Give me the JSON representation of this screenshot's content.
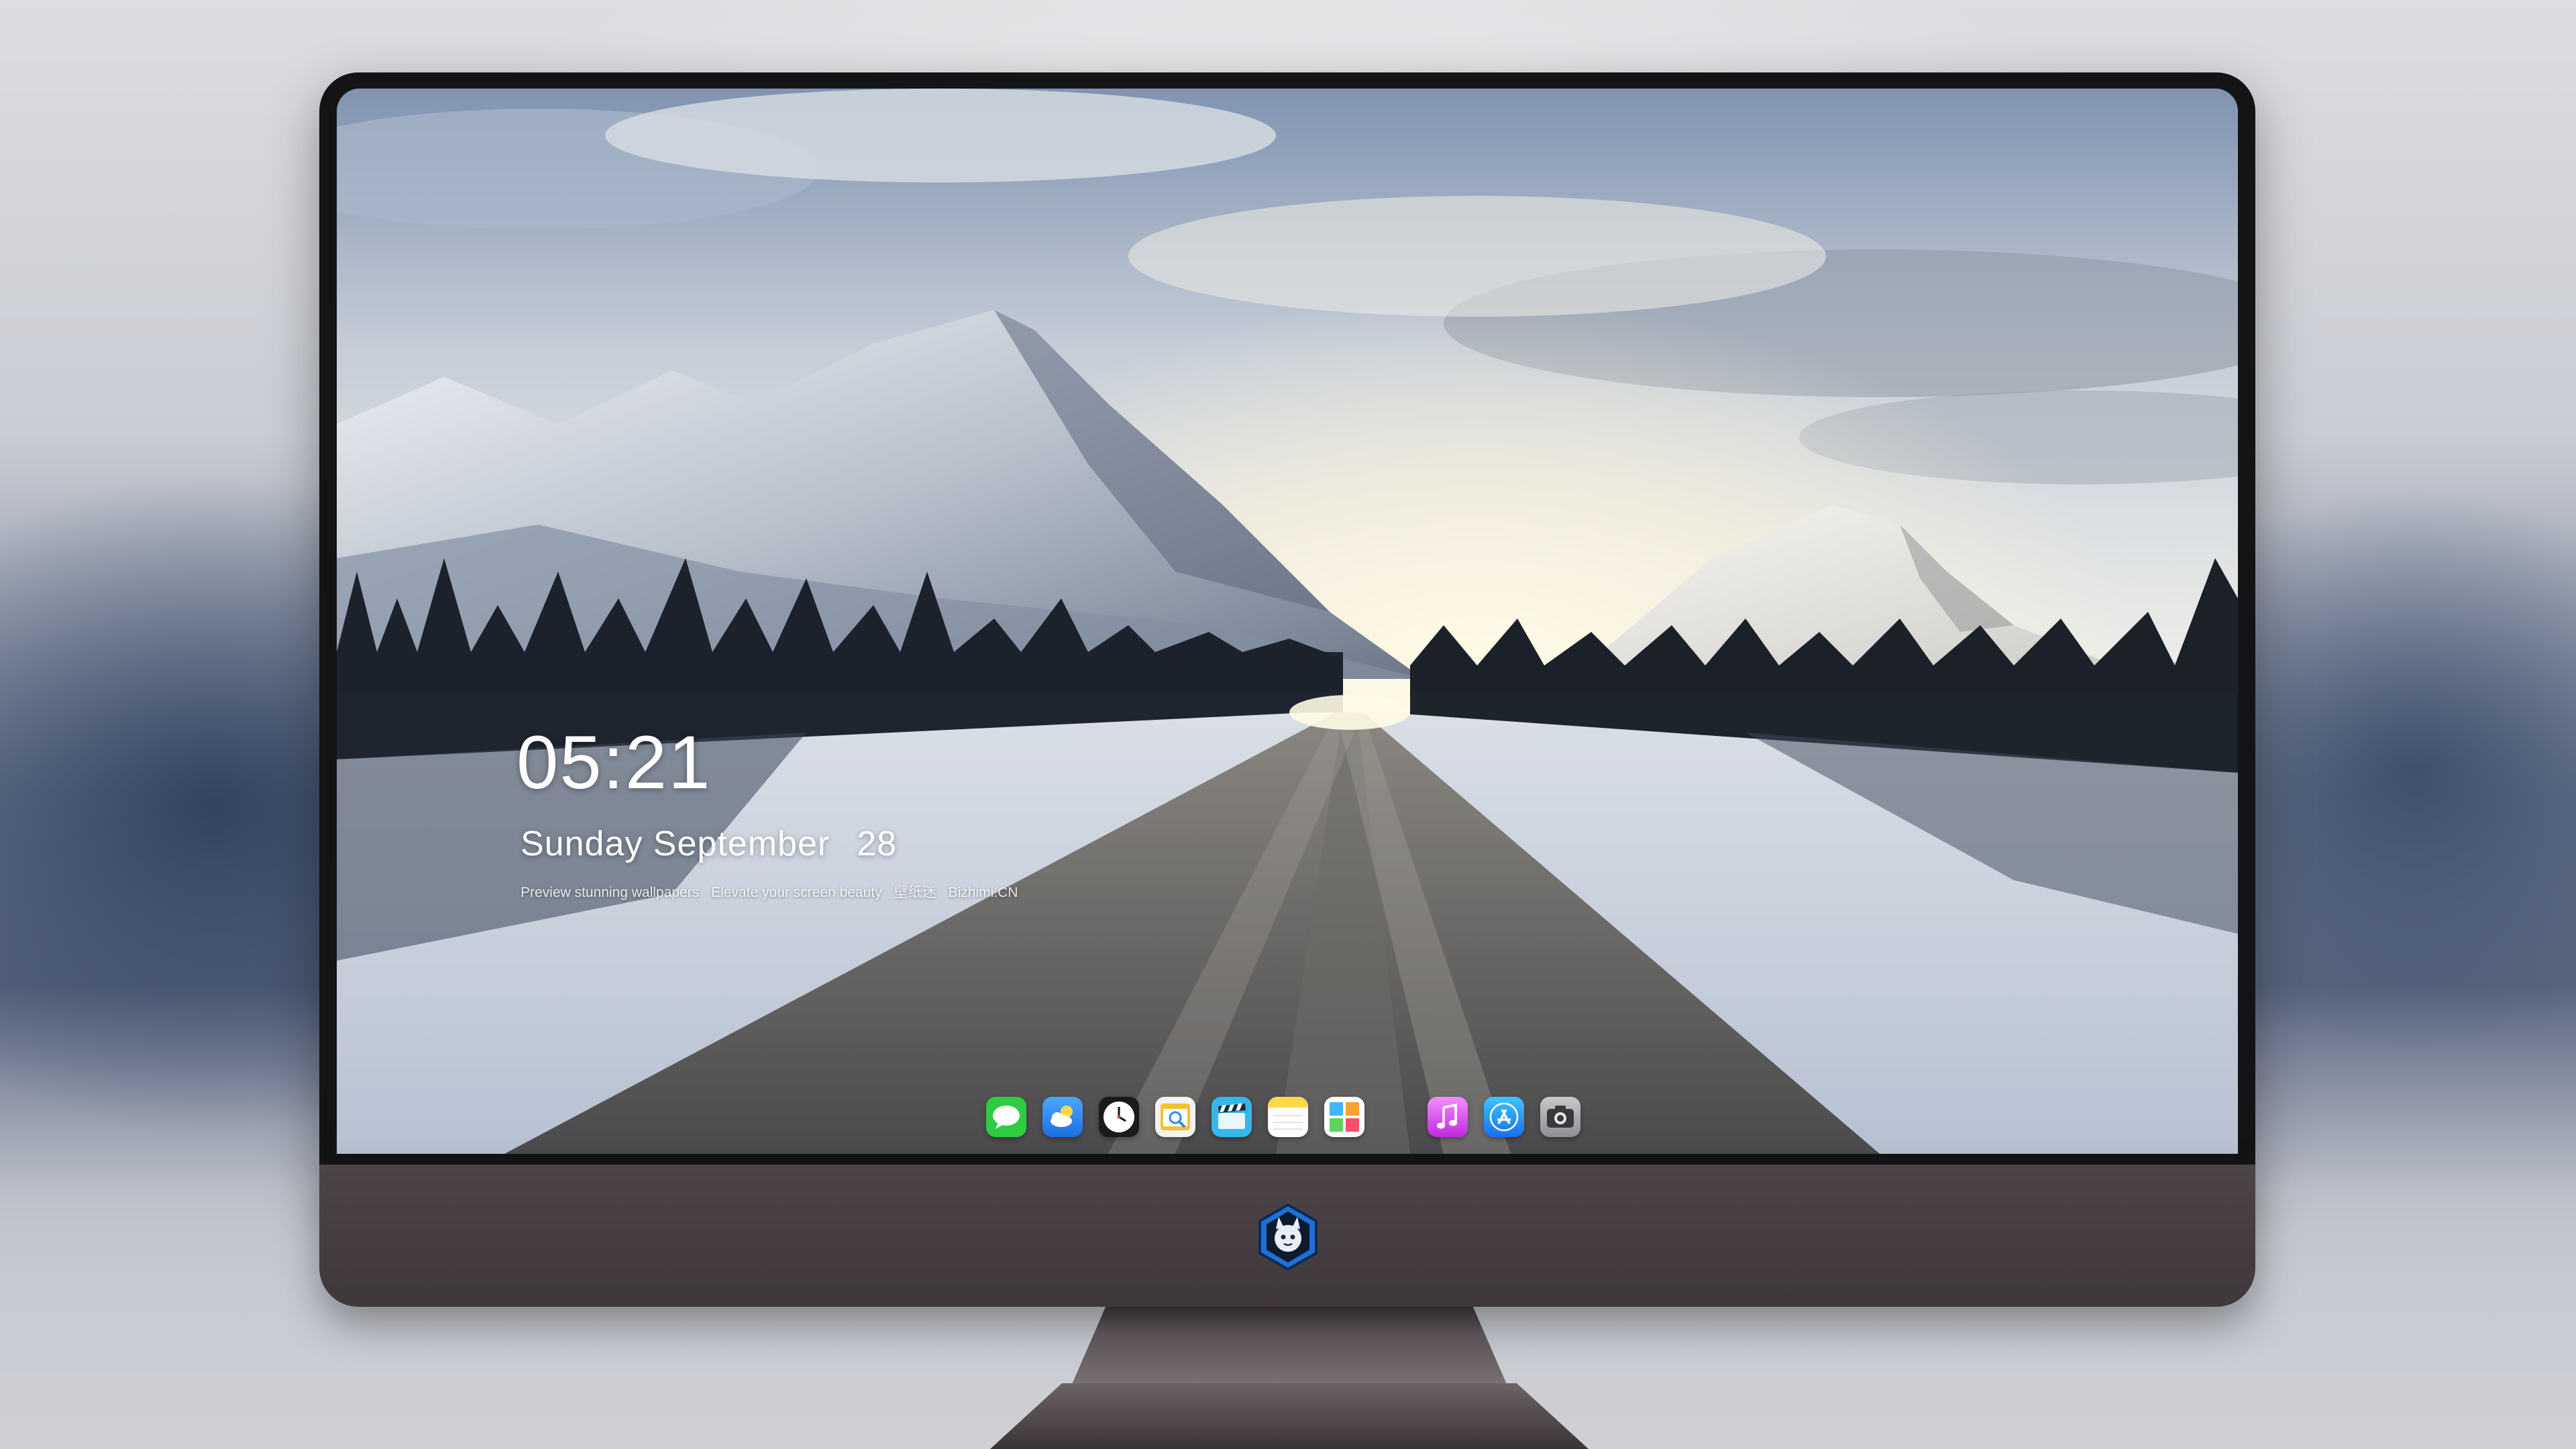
{
  "lock_screen": {
    "time": "05:21",
    "weekday_month": "Sunday September",
    "day": "28",
    "caption_parts": [
      "Preview stunning wallpapers",
      "Elevate your screen beauty",
      "壁纸迷",
      "Bizhimi.CN"
    ]
  },
  "dock": {
    "items": [
      {
        "name": "messages-icon",
        "color": "#2ecc40"
      },
      {
        "name": "weather-icon",
        "color": "#2b8cf0"
      },
      {
        "name": "clock-icon",
        "color": "#1a1a1a"
      },
      {
        "name": "preview-icon",
        "color": "#f1c232"
      },
      {
        "name": "clapper-icon",
        "color": "#35b8e8"
      },
      {
        "name": "notes-icon",
        "color": "#ffd84a"
      },
      {
        "name": "photos-icon",
        "color": "#ffffff"
      },
      {
        "name": "itunes-icon",
        "color": "#d63cf0"
      },
      {
        "name": "app-store-icon",
        "color": "#1a8cff"
      },
      {
        "name": "camera-icon",
        "color": "#8e8e93"
      }
    ]
  },
  "colors": {
    "bezel": "#141416",
    "chin": "#4d4448",
    "stand": "#6c6367"
  }
}
